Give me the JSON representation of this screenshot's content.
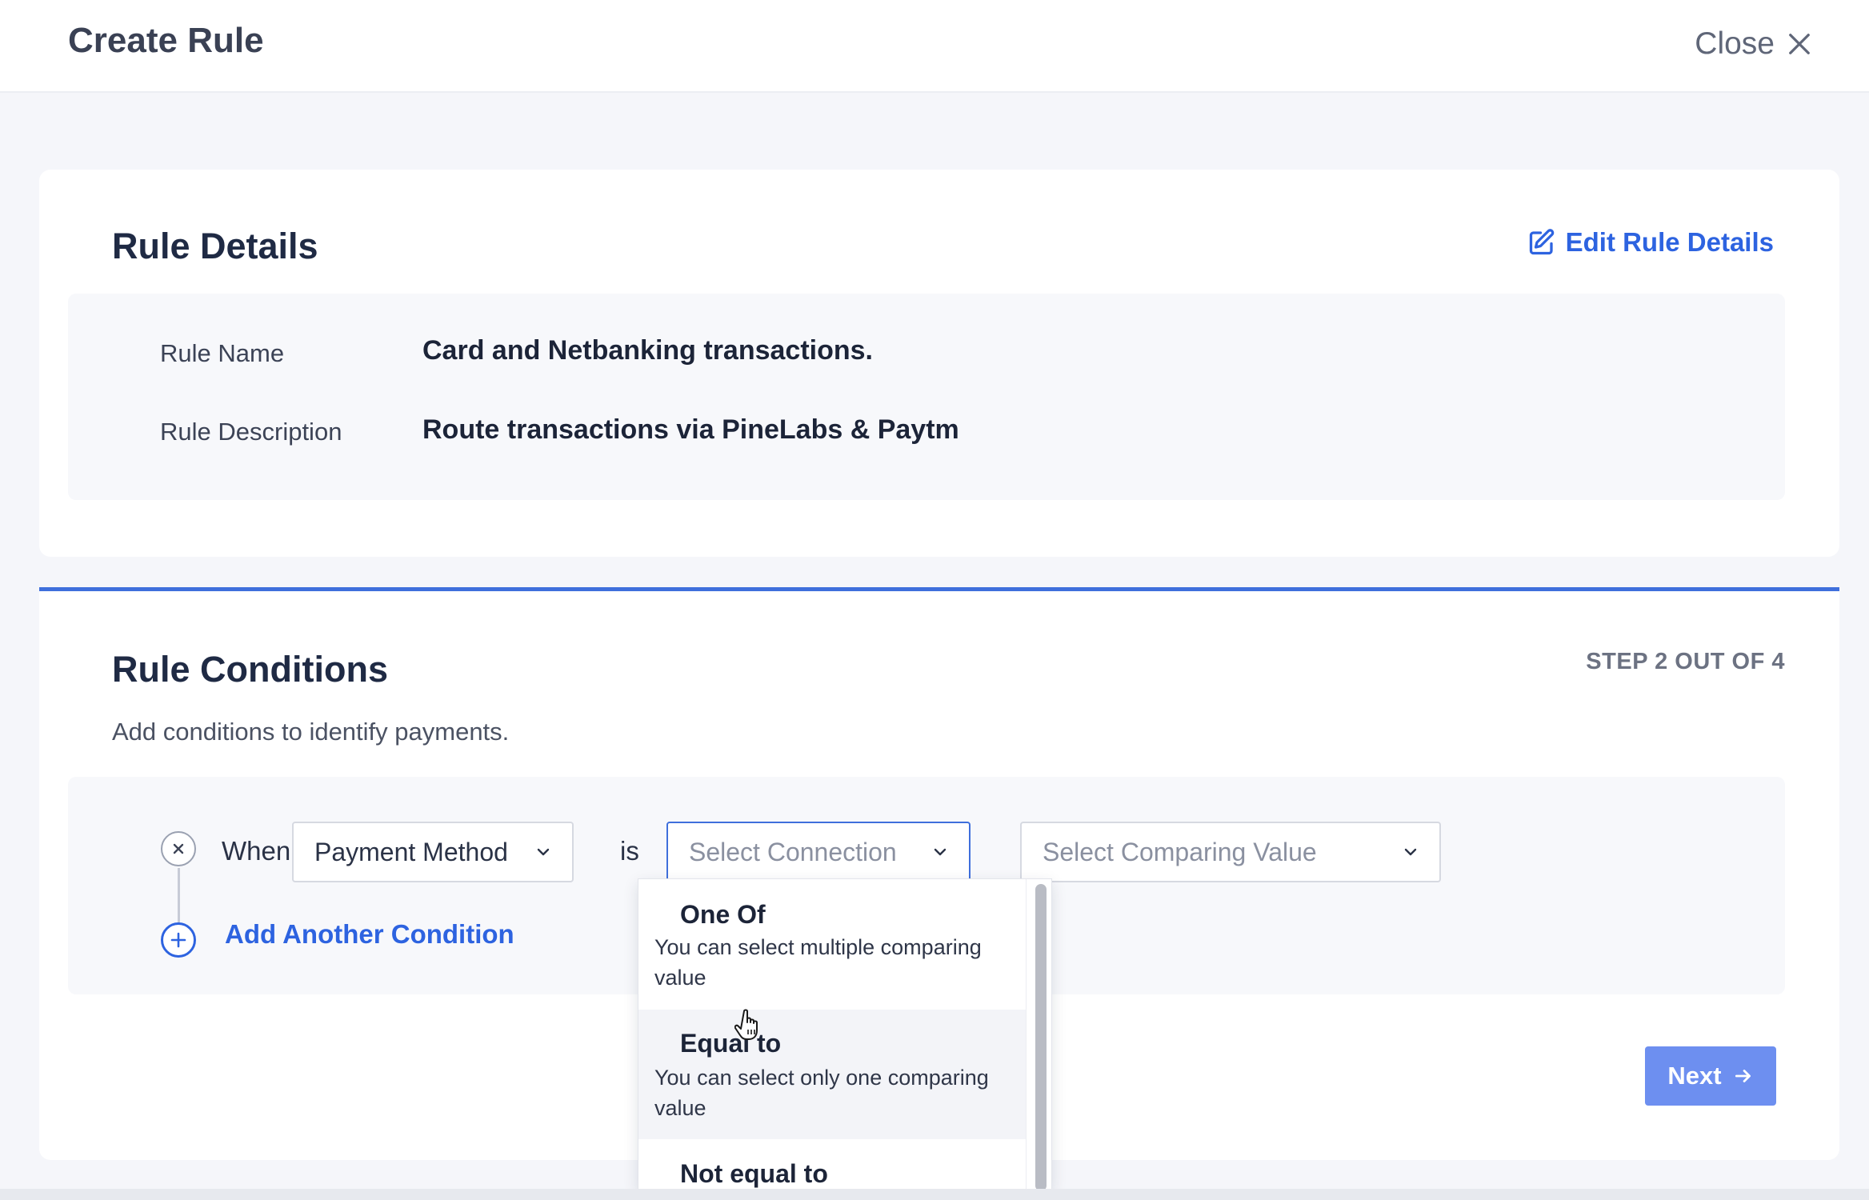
{
  "header": {
    "title": "Create Rule",
    "close_label": "Close"
  },
  "details": {
    "title": "Rule Details",
    "edit_label": "Edit Rule Details",
    "fields": [
      {
        "label": "Rule Name",
        "value": "Card and Netbanking transactions."
      },
      {
        "label": "Rule Description",
        "value": "Route transactions via PineLabs & Paytm"
      }
    ]
  },
  "conditions": {
    "title": "Rule Conditions",
    "step": "STEP 2 OUT OF 4",
    "subtitle": "Add conditions to identify payments.",
    "when_label": "When",
    "is_label": "is",
    "payment_method_value": "Payment Method",
    "connection_placeholder": "Select Connection",
    "comparing_placeholder": "Select Comparing Value",
    "add_condition_label": "Add Another Condition",
    "next_label": "Next"
  },
  "connection_dropdown": {
    "options": [
      {
        "title": "One Of",
        "description": "You can select multiple comparing value"
      },
      {
        "title": "Equal to",
        "description": "You can select only one comparing value"
      },
      {
        "title": "Not equal to",
        "description": ""
      }
    ],
    "hovered_index": 1
  },
  "colors": {
    "accent": "#2d63e0",
    "next_button": "#6d8ff0",
    "page_bg": "#f5f6fa"
  }
}
